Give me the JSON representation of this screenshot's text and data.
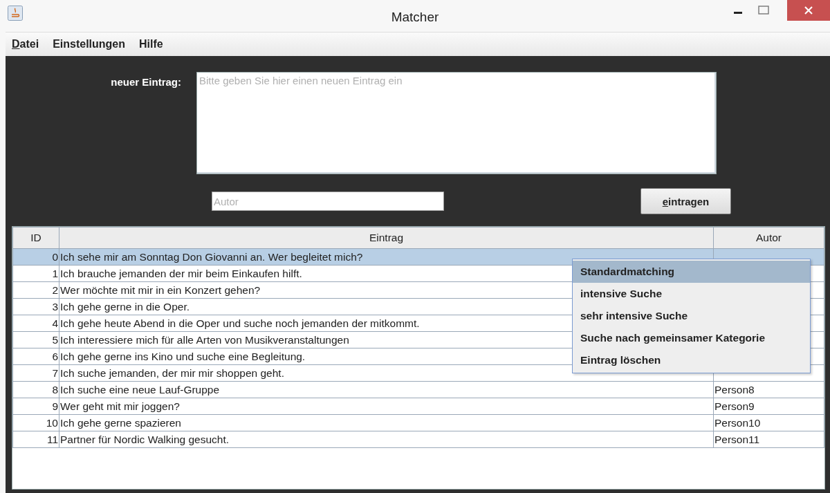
{
  "window": {
    "title": "Matcher"
  },
  "menu": [
    {
      "label": "Datei",
      "mnemonic": true
    },
    {
      "label": "Einstellungen",
      "mnemonic": false
    },
    {
      "label": "Hilfe",
      "mnemonic": false
    }
  ],
  "form": {
    "entry_label": "neuer Eintrag:",
    "entry_placeholder": "Bitte geben Sie hier einen neuen Eintrag ein",
    "author_placeholder": "Autor",
    "submit": {
      "label": "eintragen",
      "mnemonic": true
    }
  },
  "table": {
    "columns": [
      "ID",
      "Eintrag",
      "Autor"
    ],
    "rows": [
      {
        "id": "0",
        "entry": "Ich sehe mir am Sonntag Don Giovanni an. Wer begleitet mich?",
        "selected": true
      },
      {
        "id": "1",
        "entry": "Ich brauche jemanden der mir beim Einkaufen hilft.",
        "selected": false
      },
      {
        "id": "2",
        "entry": "Wer möchte mit mir in ein Konzert gehen?",
        "selected": false
      },
      {
        "id": "3",
        "entry": "Ich gehe gerne in die Oper.",
        "selected": false
      },
      {
        "id": "4",
        "entry": "Ich gehe heute Abend in die Oper und suche noch jemanden der mitkommt.",
        "selected": false
      },
      {
        "id": "5",
        "entry": "Ich interessiere mich für alle Arten von Musikveranstaltungen",
        "selected": false
      },
      {
        "id": "6",
        "entry": "Ich gehe gerne ins Kino und suche eine Begleitung.",
        "selected": false
      },
      {
        "id": "7",
        "entry": "Ich suche jemanden, der mir mir shoppen geht.",
        "selected": false
      },
      {
        "id": "8",
        "entry": "Ich suche eine neue Lauf-Gruppe",
        "author": "Person8",
        "selected": false
      },
      {
        "id": "9",
        "entry": "Wer geht mit mir joggen?",
        "author": "Person9",
        "selected": false
      },
      {
        "id": "10",
        "entry": "Ich gehe gerne spazieren",
        "author": "Person10",
        "selected": false
      },
      {
        "id": "11",
        "entry": "Partner für Nordic Walking gesucht.",
        "author": "Person11",
        "selected": false
      }
    ]
  },
  "context_menu": [
    {
      "label": "Standardmatching",
      "selected": true
    },
    {
      "label": "intensive Suche",
      "selected": false
    },
    {
      "label": "sehr intensive Suche",
      "selected": false
    },
    {
      "label": "Suche nach gemeinsamer Kategorie",
      "selected": false
    },
    {
      "label": "Eintrag löschen",
      "selected": false
    }
  ]
}
